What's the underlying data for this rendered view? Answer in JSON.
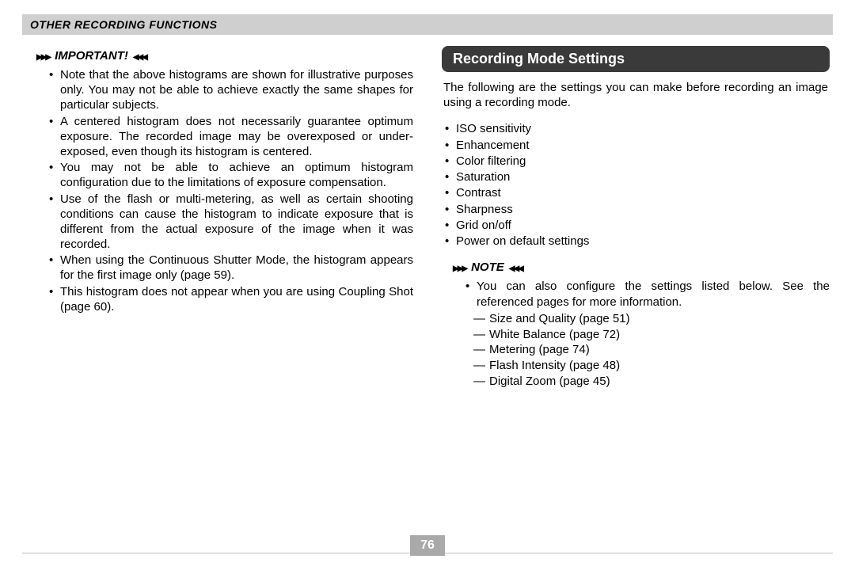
{
  "header": {
    "title": "OTHER RECORDING FUNCTIONS"
  },
  "left": {
    "callout": "IMPORTANT!",
    "bullets": [
      "Note that the above histograms are shown for illustrative purposes only. You may not be able to achieve exactly the same shapes for particular subjects.",
      "A centered histogram does not necessarily guarantee optimum exposure. The recorded image may be overexposed or under-exposed, even though its histogram is centered.",
      "You may not be able to achieve an optimum histogram configuration due to the limitations of exposure compensation.",
      "Use of the flash or multi-metering, as well as certain shooting conditions can cause the histogram to indicate exposure that is different from the actual exposure of the image when it was recorded.",
      "When using the Continuous Shutter Mode, the histogram appears for the first image only (page 59).",
      "This histogram does not appear when you are using Coupling Shot (page 60)."
    ]
  },
  "right": {
    "section_title": "Recording Mode Settings",
    "intro": "The following are the settings you can make before recording an image using a recording mode.",
    "settings": [
      "ISO sensitivity",
      "Enhancement",
      "Color filtering",
      "Saturation",
      "Contrast",
      "Sharpness",
      "Grid on/off",
      "Power on default settings"
    ],
    "note_callout": "NOTE",
    "note_bullet": "You can also configure the settings listed below. See the referenced pages for more information.",
    "note_dashes": [
      "Size and Quality (page 51)",
      "White Balance (page 72)",
      "Metering (page 74)",
      "Flash Intensity (page 48)",
      "Digital Zoom (page 45)"
    ]
  },
  "page_number": "76"
}
